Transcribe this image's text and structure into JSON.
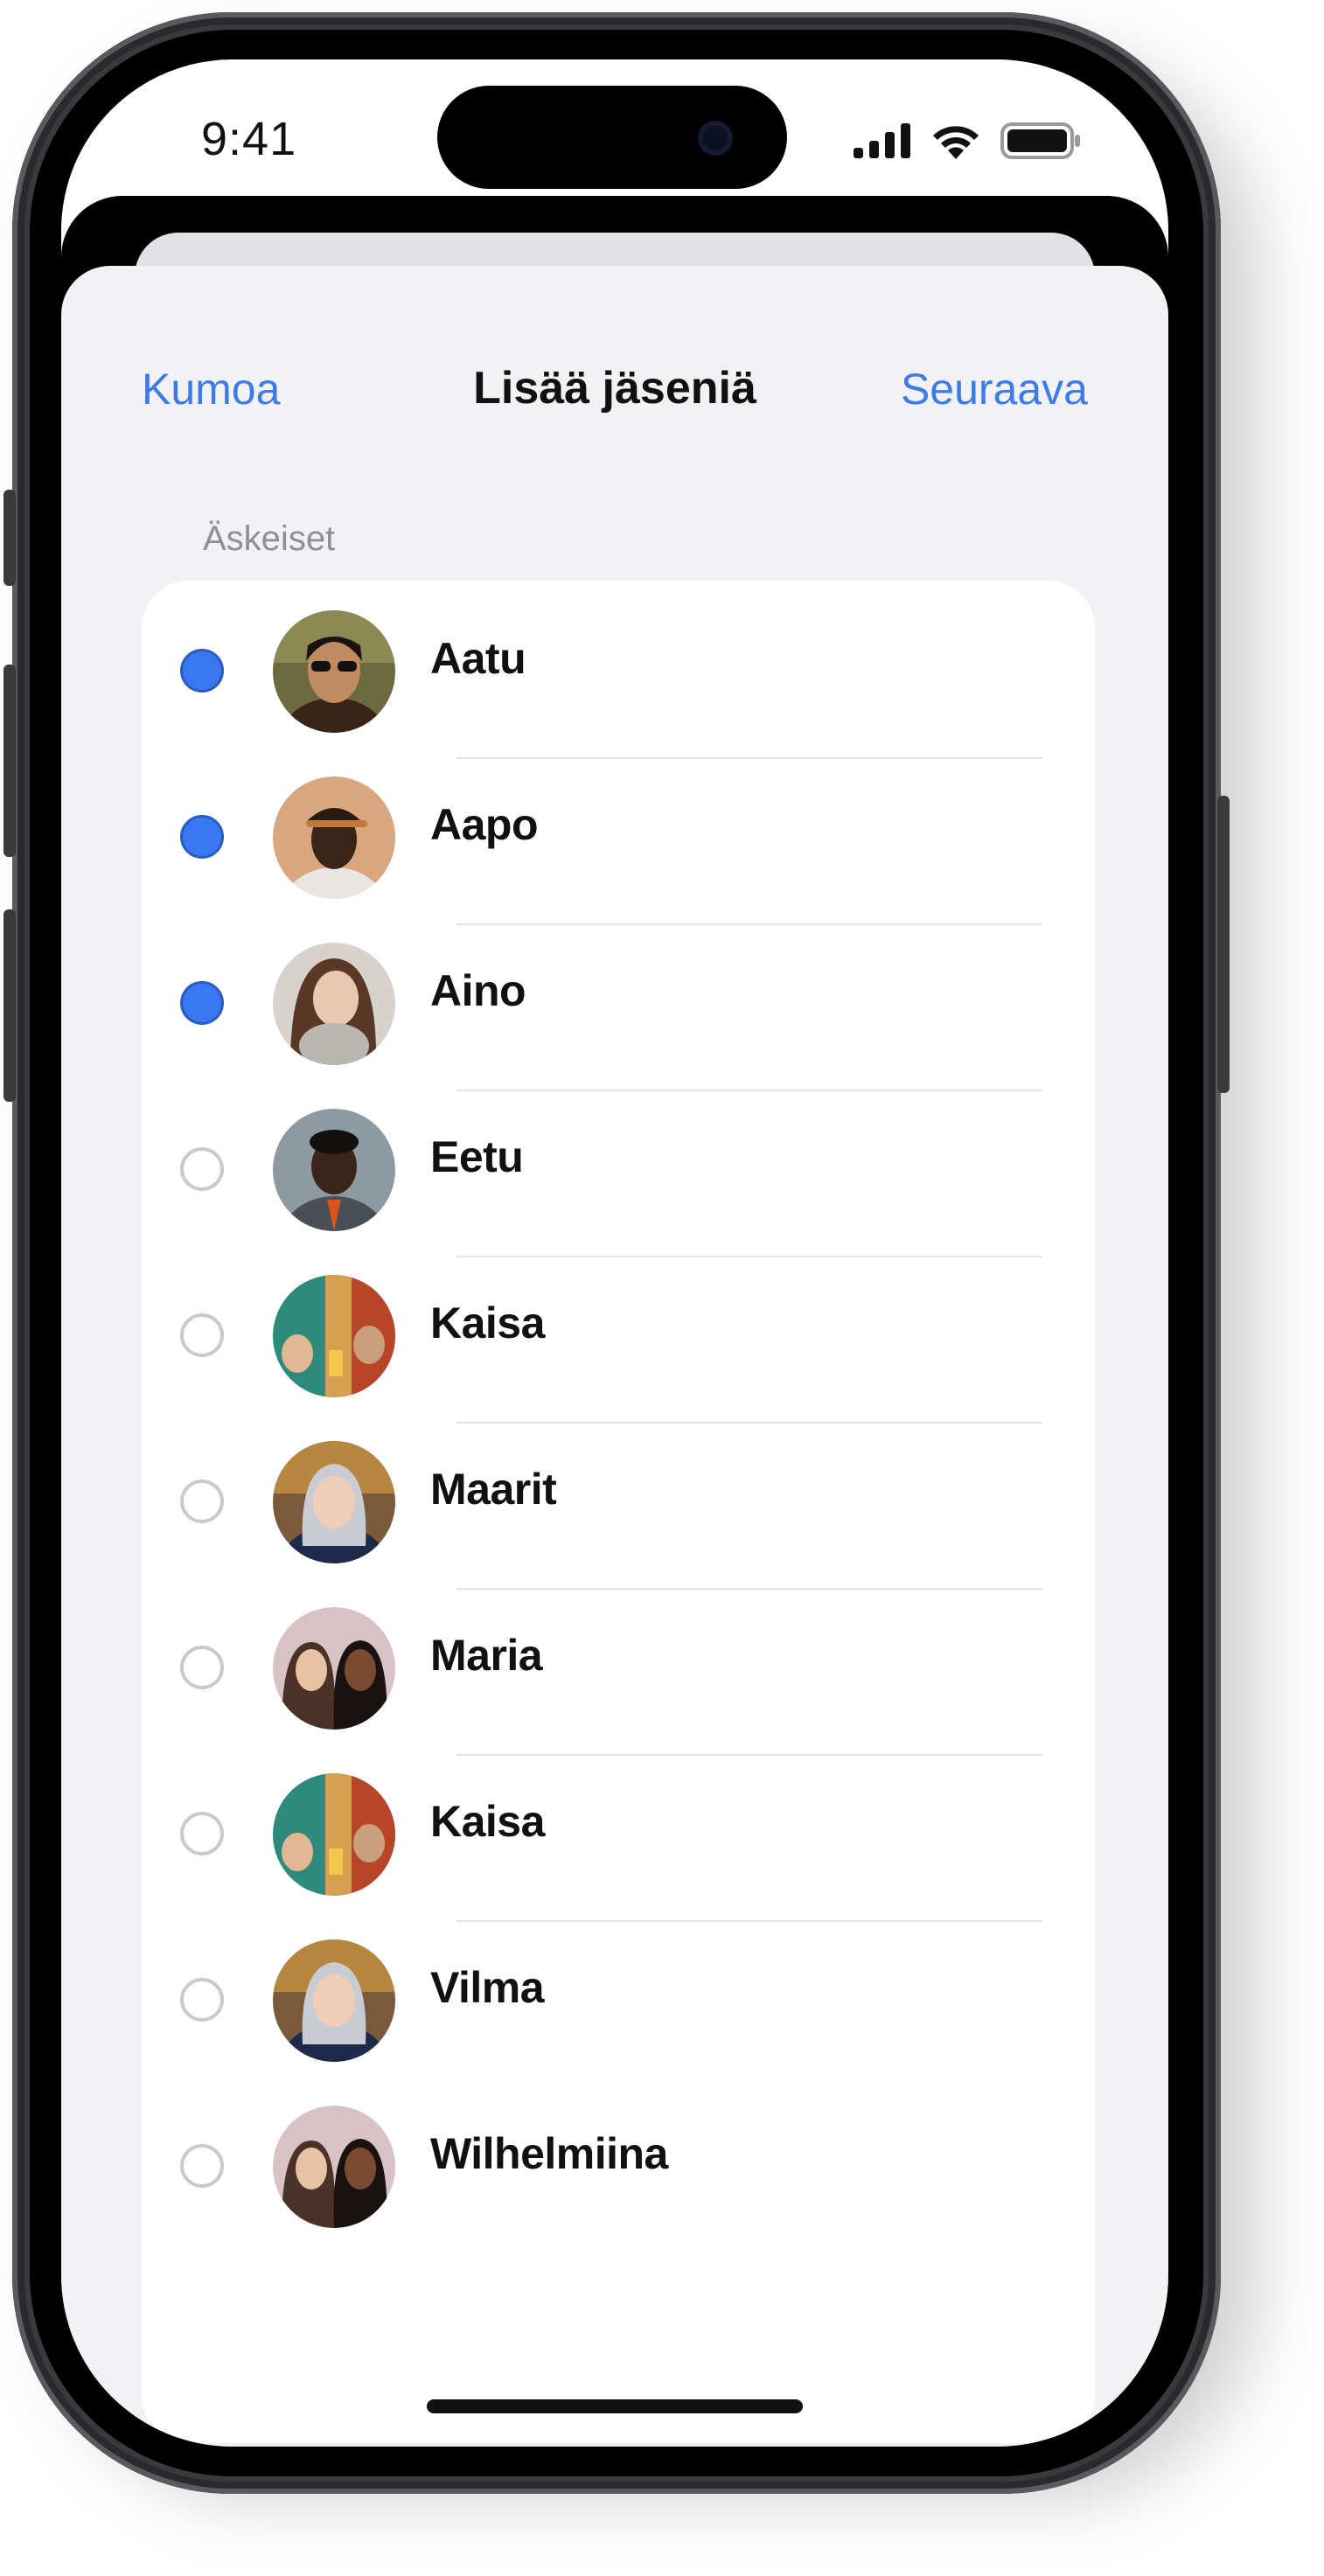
{
  "status_bar": {
    "time": "9:41",
    "icons": [
      "signal-icon",
      "wifi-icon",
      "battery-icon"
    ]
  },
  "nav": {
    "cancel": "Kumoa",
    "title": "Lisää jäseniä",
    "next": "Seuraava"
  },
  "section": {
    "label": "Äskeiset"
  },
  "colors": {
    "accent": "#3c7bea",
    "selected": "#3a78f2",
    "background": "#f2f2f4"
  },
  "contacts": [
    {
      "name": "Aatu",
      "selected": true,
      "avatar": "photo-avatar-man-sunglasses"
    },
    {
      "name": "Aapo",
      "selected": true,
      "avatar": "photo-avatar-man-cap"
    },
    {
      "name": "Aino",
      "selected": true,
      "avatar": "photo-avatar-woman-scarf"
    },
    {
      "name": "Eetu",
      "selected": false,
      "avatar": "photo-avatar-man-suit"
    },
    {
      "name": "Kaisa",
      "selected": false,
      "avatar": "photo-avatar-women-drinks"
    },
    {
      "name": "Maarit",
      "selected": false,
      "avatar": "photo-avatar-woman-hood"
    },
    {
      "name": "Maria",
      "selected": false,
      "avatar": "photo-avatar-two-women"
    },
    {
      "name": "Kaisa",
      "selected": false,
      "avatar": "photo-avatar-women-drinks"
    },
    {
      "name": "Vilma",
      "selected": false,
      "avatar": "photo-avatar-woman-hood"
    },
    {
      "name": "Wilhelmiina",
      "selected": false,
      "avatar": "photo-avatar-two-women"
    }
  ]
}
